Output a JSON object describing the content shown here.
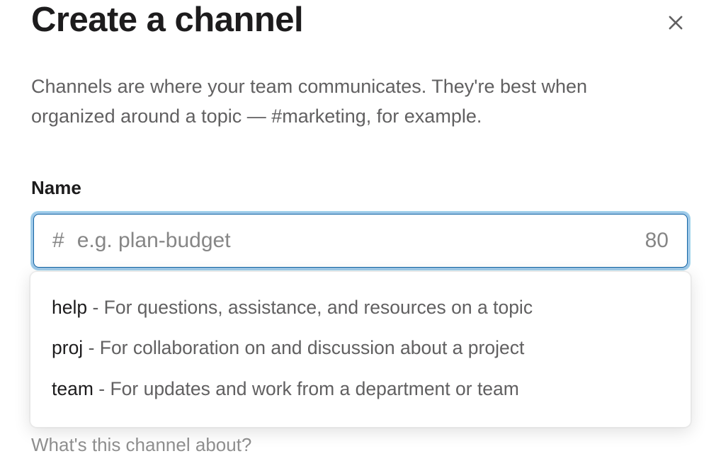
{
  "header": {
    "title": "Create a channel"
  },
  "description": "Channels are where your team communicates. They're best when organized around a topic — #marketing, for example.",
  "name_field": {
    "label": "Name",
    "hash": "#",
    "placeholder": "e.g. plan-budget",
    "value": "",
    "char_count": "80"
  },
  "suggestions": [
    {
      "prefix": "help",
      "desc": " - For questions, assistance, and resources on a topic"
    },
    {
      "prefix": "proj",
      "desc": " - For collaboration on and discussion about a project"
    },
    {
      "prefix": "team",
      "desc": " - For updates and work from a department or team"
    }
  ],
  "under_text": "What's this channel about?"
}
